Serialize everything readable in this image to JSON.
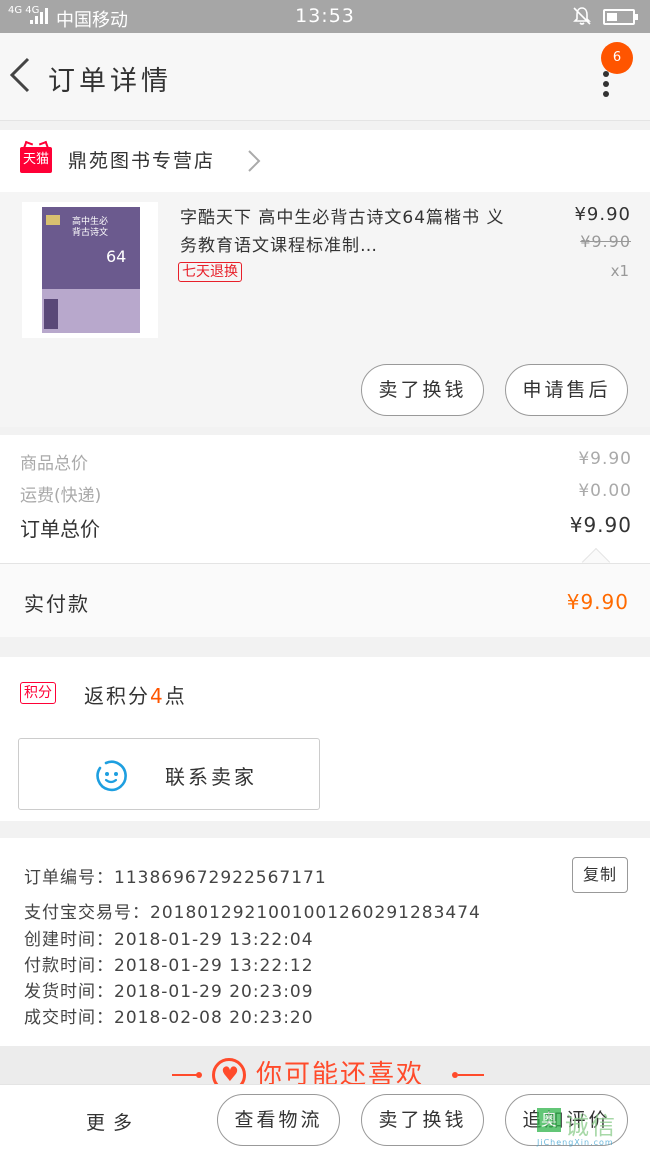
{
  "status_bar": {
    "signal": "4G 4G",
    "carrier": "中国移动",
    "time": "13:53"
  },
  "header": {
    "title": "订单详情",
    "badge_count": "6"
  },
  "shop": {
    "badge": "天猫",
    "name": "鼎苑图书专营店"
  },
  "product": {
    "cover_text": "高中生必背古诗文",
    "cover_number": "64",
    "title": "字酷天下 高中生必背古诗文64篇楷书 义务教育语文课程标准制…",
    "tag": "七天退换",
    "price": "¥9.90",
    "original_price": "¥9.90",
    "quantity": "x1",
    "btn_refund": "卖了换钱",
    "btn_aftersale": "申请售后"
  },
  "summary": {
    "goods_label": "商品总价",
    "goods_value": "¥9.90",
    "shipping_label": "运费(快递)",
    "shipping_value": "¥0.00",
    "total_label": "订单总价",
    "total_value": "¥9.90",
    "paid_label": "实付款",
    "paid_value": "¥9.90"
  },
  "points": {
    "badge": "积分",
    "prefix": "返积分",
    "value": "4",
    "suffix": "点"
  },
  "contact": {
    "label": "联系卖家"
  },
  "order_info": {
    "order_no": "订单编号：113869672922567171",
    "copy": "复制",
    "alipay_no": "支付宝交易号：2018012921001001260291283474",
    "created": "创建时间：2018-01-29  13:22:04",
    "paid": "付款时间：2018-01-29  13:22:12",
    "shipped": "发货时间：2018-01-29  20:23:09",
    "completed": "成交时间：2018-02-08  20:23:20"
  },
  "recommend": {
    "label": "你可能还喜欢"
  },
  "bottom_bar": {
    "more": "更多",
    "logistics": "查看物流",
    "sell": "卖了换钱",
    "review": "追加评价"
  },
  "watermark": {
    "glyph": "奥",
    "text": "诚信",
    "url": "JiChengXin.com"
  },
  "colors": {
    "accent": "#ff5500",
    "tmall_red": "#ff0036",
    "paid_orange": "#ff6a00"
  }
}
